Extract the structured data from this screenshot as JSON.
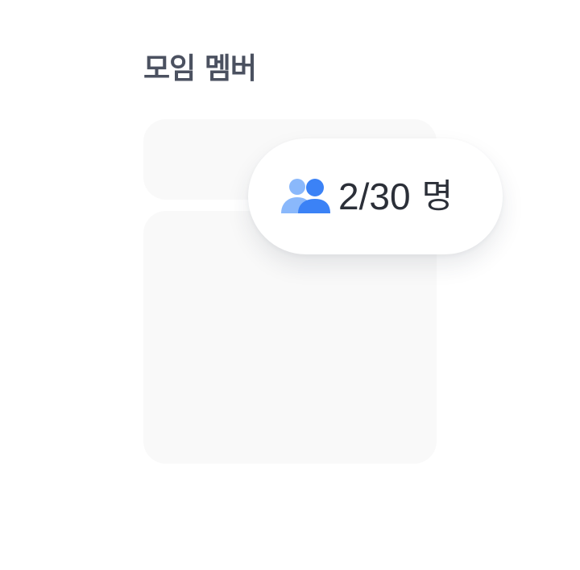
{
  "section": {
    "title": "모임 멤버"
  },
  "member_count": {
    "icon": "people-icon",
    "current": 2,
    "max": 30,
    "count_text": "2/30",
    "unit": "명",
    "accent_color": "#3b82f6",
    "accent_light_color": "#8ab8fb"
  }
}
